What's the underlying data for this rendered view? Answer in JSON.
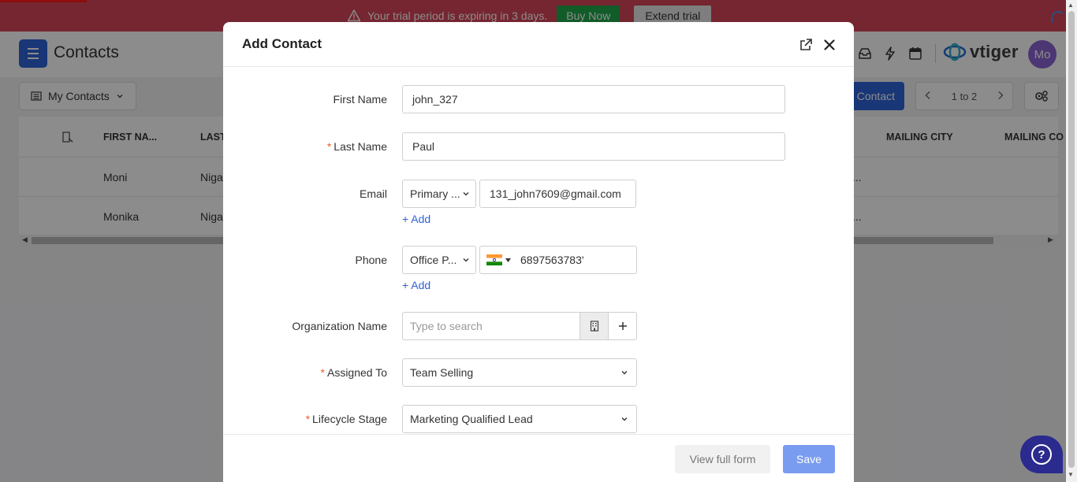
{
  "trial": {
    "message": "Your trial period is expiring in 3 days.",
    "buy_label": "Buy Now",
    "extend_label": "Extend trial"
  },
  "header": {
    "title": "Contacts",
    "logo_text": "vtiger",
    "avatar_initials": "Mo"
  },
  "list": {
    "view_label": "My Contacts",
    "add_button_label": "Contact",
    "pager_label": "1 to 2",
    "columns": [
      "FIRST NA...",
      "LAST",
      "MAILING CITY",
      "MAILING CO"
    ],
    "rows": [
      {
        "first": "Moni",
        "last": "Niga",
        "ellipsis": "..."
      },
      {
        "first": "Monika",
        "last": "Niga",
        "ellipsis": "..."
      }
    ]
  },
  "modal": {
    "title": "Add Contact",
    "fields": {
      "first_name": {
        "label": "First Name",
        "value": "john_327"
      },
      "last_name": {
        "label": "Last Name",
        "value": "Paul"
      },
      "email": {
        "label": "Email",
        "type": "Primary ...",
        "value": "131_john7609@gmail.com",
        "add_label": "+ Add"
      },
      "phone": {
        "label": "Phone",
        "type": "Office P...",
        "value": "6897563783'",
        "add_label": "+ Add"
      },
      "organization": {
        "label": "Organization Name",
        "placeholder": "Type to search"
      },
      "assigned_to": {
        "label": "Assigned To",
        "value": "Team Selling"
      },
      "lifecycle": {
        "label": "Lifecycle Stage",
        "value": "Marketing Qualified Lead"
      }
    },
    "footer": {
      "view_full_label": "View full form",
      "save_label": "Save"
    }
  },
  "colors": {
    "trial_banner": "#d6455a",
    "primary": "#2e63d8",
    "buy_button": "#20a84c",
    "save_button": "#7a9cf0",
    "required": "#e8612c"
  }
}
